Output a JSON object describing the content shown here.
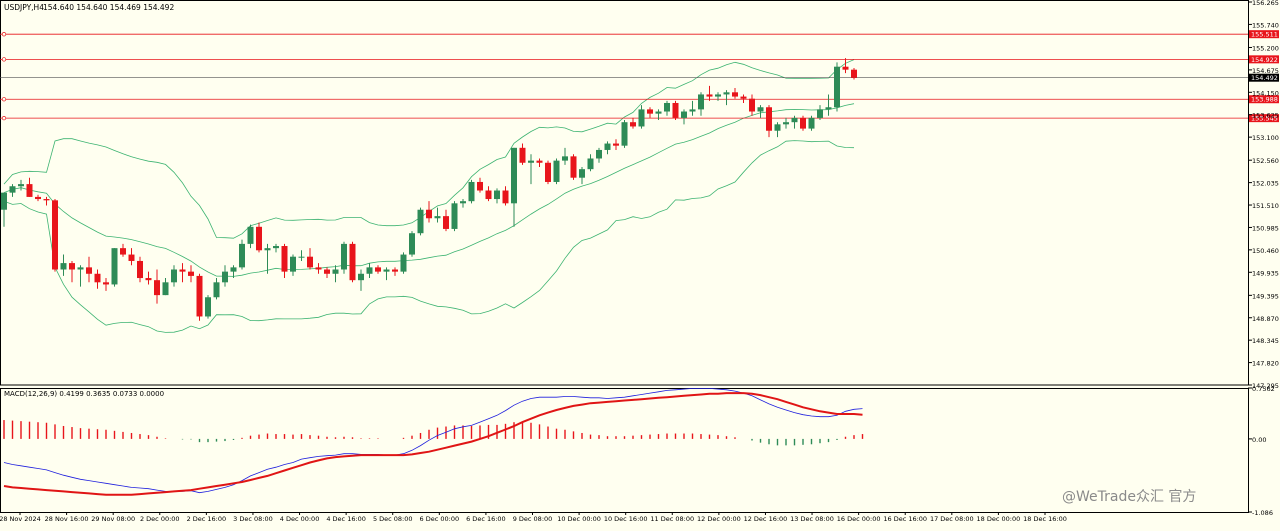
{
  "header": {
    "symbol": "USDJPY,H4",
    "ohlc": "154.640 154.640 154.469 154.492"
  },
  "macd_header": "MACD(12,26,9) 0.4199 0.3635 0.0733 0.0000",
  "watermark": "@WeTrade众汇 官方",
  "colors": {
    "background": "#fffff0",
    "bull": "#2e8b57",
    "bear": "#e8151b",
    "bands": "#3cb371",
    "hline": "#e8151b",
    "macd_line": "#1f1fdd",
    "signal_line": "#e01515",
    "price_tag": "#e8151b",
    "current_tag": "#000000"
  },
  "chart_data": [
    {
      "type": "candlestick",
      "title": "USDJPY,H4",
      "ylim": [
        147.295,
        156.265
      ],
      "y_ticks": [
        "156.265",
        "155.740",
        "155.200",
        "154.675",
        "154.150",
        "153.625",
        "153.100",
        "152.560",
        "152.035",
        "151.510",
        "150.985",
        "150.460",
        "149.935",
        "149.395",
        "148.870",
        "148.345",
        "147.820",
        "147.295"
      ],
      "x_ticks": [
        "28 Nov 2024",
        "28 Nov 16:00",
        "29 Nov 08:00",
        "2 Dec 00:00",
        "2 Dec 16:00",
        "3 Dec 08:00",
        "4 Dec 00:00",
        "4 Dec 16:00",
        "5 Dec 08:00",
        "6 Dec 00:00",
        "6 Dec 16:00",
        "9 Dec 08:00",
        "10 Dec 00:00",
        "10 Dec 16:00",
        "11 Dec 08:00",
        "12 Dec 00:00",
        "12 Dec 16:00",
        "13 Dec 08:00",
        "16 Dec 00:00",
        "16 Dec 16:00",
        "17 Dec 08:00",
        "18 Dec 00:00",
        "18 Dec 16:00"
      ],
      "horizontal_levels": [
        155.511,
        154.922,
        153.988,
        153.545
      ],
      "current_price": 154.492,
      "candles": [
        [
          151.4,
          151.8,
          151.0,
          151.8
        ],
        [
          151.8,
          152.0,
          151.7,
          151.95
        ],
        [
          151.95,
          152.1,
          151.85,
          152.0
        ],
        [
          152.0,
          152.15,
          151.7,
          151.7
        ],
        [
          151.7,
          151.75,
          151.6,
          151.65
        ],
        [
          151.65,
          151.7,
          151.5,
          151.62
        ],
        [
          151.62,
          151.65,
          149.95,
          150.0
        ],
        [
          150.0,
          150.35,
          149.85,
          150.15
        ],
        [
          150.15,
          150.2,
          149.7,
          150.0
        ],
        [
          150.0,
          150.1,
          149.6,
          150.05
        ],
        [
          150.05,
          150.3,
          149.7,
          149.9
        ],
        [
          149.9,
          150.0,
          149.55,
          149.7
        ],
        [
          149.7,
          149.8,
          149.5,
          149.65
        ],
        [
          149.65,
          150.5,
          149.6,
          150.5
        ],
        [
          150.5,
          150.6,
          150.3,
          150.35
        ],
        [
          150.35,
          150.5,
          150.1,
          150.2
        ],
        [
          150.2,
          150.3,
          149.7,
          149.8
        ],
        [
          149.8,
          149.95,
          149.65,
          149.75
        ],
        [
          149.75,
          150.0,
          149.2,
          149.4
        ],
        [
          149.4,
          149.8,
          149.4,
          149.7
        ],
        [
          149.7,
          150.1,
          149.6,
          150.0
        ],
        [
          150.0,
          150.15,
          149.7,
          149.95
        ],
        [
          149.95,
          150.1,
          149.7,
          149.85
        ],
        [
          149.85,
          149.9,
          148.8,
          148.9
        ],
        [
          148.9,
          149.4,
          148.85,
          149.35
        ],
        [
          149.35,
          149.8,
          149.3,
          149.7
        ],
        [
          149.7,
          150.1,
          149.6,
          149.95
        ],
        [
          149.95,
          150.1,
          149.8,
          150.05
        ],
        [
          150.05,
          150.7,
          150.0,
          150.6
        ],
        [
          150.6,
          151.05,
          150.5,
          151.0
        ],
        [
          151.0,
          151.1,
          150.4,
          150.45
        ],
        [
          150.45,
          150.6,
          149.9,
          150.5
        ],
        [
          150.5,
          150.6,
          150.4,
          150.55
        ],
        [
          150.55,
          150.6,
          149.8,
          149.95
        ],
        [
          149.95,
          150.35,
          149.85,
          150.3
        ],
        [
          150.3,
          150.45,
          150.2,
          150.3
        ],
        [
          150.3,
          150.5,
          150.0,
          150.05
        ],
        [
          150.05,
          150.15,
          149.9,
          150.0
        ],
        [
          150.0,
          150.05,
          149.8,
          149.9
        ],
        [
          149.9,
          150.1,
          149.7,
          150.0
        ],
        [
          150.0,
          150.65,
          149.9,
          150.6
        ],
        [
          150.6,
          150.65,
          149.7,
          149.75
        ],
        [
          149.75,
          150.0,
          149.5,
          149.9
        ],
        [
          149.9,
          150.15,
          149.8,
          150.05
        ],
        [
          150.05,
          150.1,
          149.9,
          149.95
        ],
        [
          149.95,
          150.05,
          149.75,
          150.0
        ],
        [
          150.0,
          150.05,
          149.85,
          149.95
        ],
        [
          149.95,
          150.4,
          149.9,
          150.35
        ],
        [
          150.35,
          150.9,
          150.3,
          150.85
        ],
        [
          150.85,
          151.45,
          150.8,
          151.4
        ],
        [
          151.4,
          151.6,
          151.1,
          151.2
        ],
        [
          151.2,
          151.45,
          151.1,
          151.25
        ],
        [
          151.25,
          151.4,
          150.9,
          150.95
        ],
        [
          150.95,
          151.6,
          150.9,
          151.55
        ],
        [
          151.55,
          151.65,
          151.45,
          151.6
        ],
        [
          151.6,
          152.1,
          151.55,
          152.05
        ],
        [
          152.05,
          152.15,
          151.8,
          151.85
        ],
        [
          151.85,
          151.95,
          151.6,
          151.65
        ],
        [
          151.65,
          151.9,
          151.55,
          151.85
        ],
        [
          151.85,
          151.95,
          151.5,
          151.55
        ],
        [
          151.55,
          152.85,
          151.0,
          152.85
        ],
        [
          152.85,
          152.95,
          152.45,
          152.5
        ],
        [
          152.5,
          152.7,
          152.0,
          152.55
        ],
        [
          152.55,
          152.6,
          152.4,
          152.5
        ],
        [
          152.5,
          152.55,
          152.0,
          152.05
        ],
        [
          152.05,
          152.6,
          152.0,
          152.55
        ],
        [
          152.55,
          152.85,
          152.45,
          152.65
        ],
        [
          152.65,
          152.7,
          152.1,
          152.15
        ],
        [
          152.15,
          152.4,
          152.0,
          152.35
        ],
        [
          152.35,
          152.7,
          152.3,
          152.6
        ],
        [
          152.6,
          152.85,
          152.5,
          152.8
        ],
        [
          152.8,
          153.0,
          152.7,
          152.95
        ],
        [
          152.95,
          153.05,
          152.8,
          152.9
        ],
        [
          152.9,
          153.5,
          152.85,
          153.45
        ],
        [
          153.45,
          153.55,
          153.3,
          153.35
        ],
        [
          153.35,
          153.85,
          153.3,
          153.75
        ],
        [
          153.75,
          153.8,
          153.55,
          153.65
        ],
        [
          153.65,
          153.75,
          153.5,
          153.7
        ],
        [
          153.7,
          153.95,
          153.6,
          153.9
        ],
        [
          153.9,
          153.95,
          153.5,
          153.55
        ],
        [
          153.55,
          153.75,
          153.4,
          153.7
        ],
        [
          153.7,
          153.95,
          153.6,
          153.75
        ],
        [
          153.75,
          154.15,
          153.6,
          154.1
        ],
        [
          154.1,
          154.3,
          153.95,
          154.05
        ],
        [
          154.05,
          154.15,
          153.95,
          154.1
        ],
        [
          154.1,
          154.2,
          153.85,
          154.15
        ],
        [
          154.15,
          154.25,
          154.0,
          154.05
        ],
        [
          154.05,
          154.1,
          153.9,
          154.0
        ],
        [
          154.0,
          154.1,
          153.6,
          153.7
        ],
        [
          153.7,
          153.85,
          153.55,
          153.8
        ],
        [
          153.8,
          153.85,
          153.1,
          153.25
        ],
        [
          153.25,
          153.45,
          153.1,
          153.4
        ],
        [
          153.4,
          153.55,
          153.3,
          153.45
        ],
        [
          153.45,
          153.6,
          153.3,
          153.55
        ],
        [
          153.55,
          153.6,
          153.25,
          153.3
        ],
        [
          153.3,
          153.6,
          153.25,
          153.55
        ],
        [
          153.55,
          153.85,
          153.5,
          153.75
        ],
        [
          153.75,
          154.1,
          153.6,
          153.8
        ],
        [
          153.8,
          154.85,
          153.7,
          154.75
        ],
        [
          154.75,
          154.95,
          154.6,
          154.68
        ],
        [
          154.68,
          154.72,
          154.45,
          154.49
        ]
      ]
    },
    {
      "type": "histogram",
      "title": "MACD(12,26,9) 0.4199 0.3635 0.0733 0.0000",
      "ylim": [
        -1.086,
        0.7562
      ],
      "y_ticks": [
        "0.7562",
        "0.00",
        "-1.086"
      ],
      "series": [
        {
          "name": "MACD",
          "values": [
            -0.35,
            -0.38,
            -0.4,
            -0.42,
            -0.44,
            -0.46,
            -0.5,
            -0.54,
            -0.57,
            -0.6,
            -0.62,
            -0.64,
            -0.66,
            -0.68,
            -0.7,
            -0.72,
            -0.73,
            -0.74,
            -0.76,
            -0.78,
            -0.78,
            -0.78,
            -0.77,
            -0.8,
            -0.78,
            -0.75,
            -0.72,
            -0.68,
            -0.62,
            -0.55,
            -0.5,
            -0.45,
            -0.42,
            -0.38,
            -0.35,
            -0.3,
            -0.28,
            -0.26,
            -0.25,
            -0.24,
            -0.22,
            -0.22,
            -0.23,
            -0.23,
            -0.23,
            -0.24,
            -0.24,
            -0.22,
            -0.17,
            -0.1,
            -0.02,
            0.05,
            0.1,
            0.15,
            0.18,
            0.2,
            0.25,
            0.3,
            0.35,
            0.42,
            0.5,
            0.56,
            0.6,
            0.62,
            0.62,
            0.62,
            0.63,
            0.63,
            0.62,
            0.61,
            0.61,
            0.6,
            0.61,
            0.62,
            0.64,
            0.66,
            0.68,
            0.7,
            0.72,
            0.73,
            0.74,
            0.75,
            0.75,
            0.75,
            0.74,
            0.73,
            0.71,
            0.68,
            0.64,
            0.58,
            0.52,
            0.47,
            0.43,
            0.39,
            0.36,
            0.34,
            0.33,
            0.33,
            0.35,
            0.41,
            0.44,
            0.45
          ]
        },
        {
          "name": "Signal",
          "values": [
            -0.7,
            -0.72,
            -0.73,
            -0.74,
            -0.75,
            -0.76,
            -0.77,
            -0.78,
            -0.79,
            -0.8,
            -0.81,
            -0.82,
            -0.83,
            -0.83,
            -0.83,
            -0.83,
            -0.82,
            -0.81,
            -0.8,
            -0.79,
            -0.78,
            -0.77,
            -0.76,
            -0.74,
            -0.72,
            -0.7,
            -0.68,
            -0.66,
            -0.64,
            -0.61,
            -0.58,
            -0.55,
            -0.51,
            -0.47,
            -0.43,
            -0.39,
            -0.35,
            -0.32,
            -0.29,
            -0.27,
            -0.26,
            -0.25,
            -0.24,
            -0.24,
            -0.24,
            -0.24,
            -0.24,
            -0.24,
            -0.23,
            -0.21,
            -0.19,
            -0.16,
            -0.13,
            -0.1,
            -0.07,
            -0.04,
            0.0,
            0.04,
            0.09,
            0.14,
            0.19,
            0.25,
            0.3,
            0.35,
            0.39,
            0.43,
            0.46,
            0.49,
            0.51,
            0.53,
            0.54,
            0.55,
            0.56,
            0.57,
            0.58,
            0.59,
            0.6,
            0.61,
            0.62,
            0.63,
            0.64,
            0.65,
            0.66,
            0.67,
            0.67,
            0.68,
            0.68,
            0.68,
            0.67,
            0.65,
            0.62,
            0.59,
            0.55,
            0.51,
            0.47,
            0.44,
            0.41,
            0.39,
            0.37,
            0.37,
            0.37,
            0.36
          ]
        }
      ]
    }
  ]
}
